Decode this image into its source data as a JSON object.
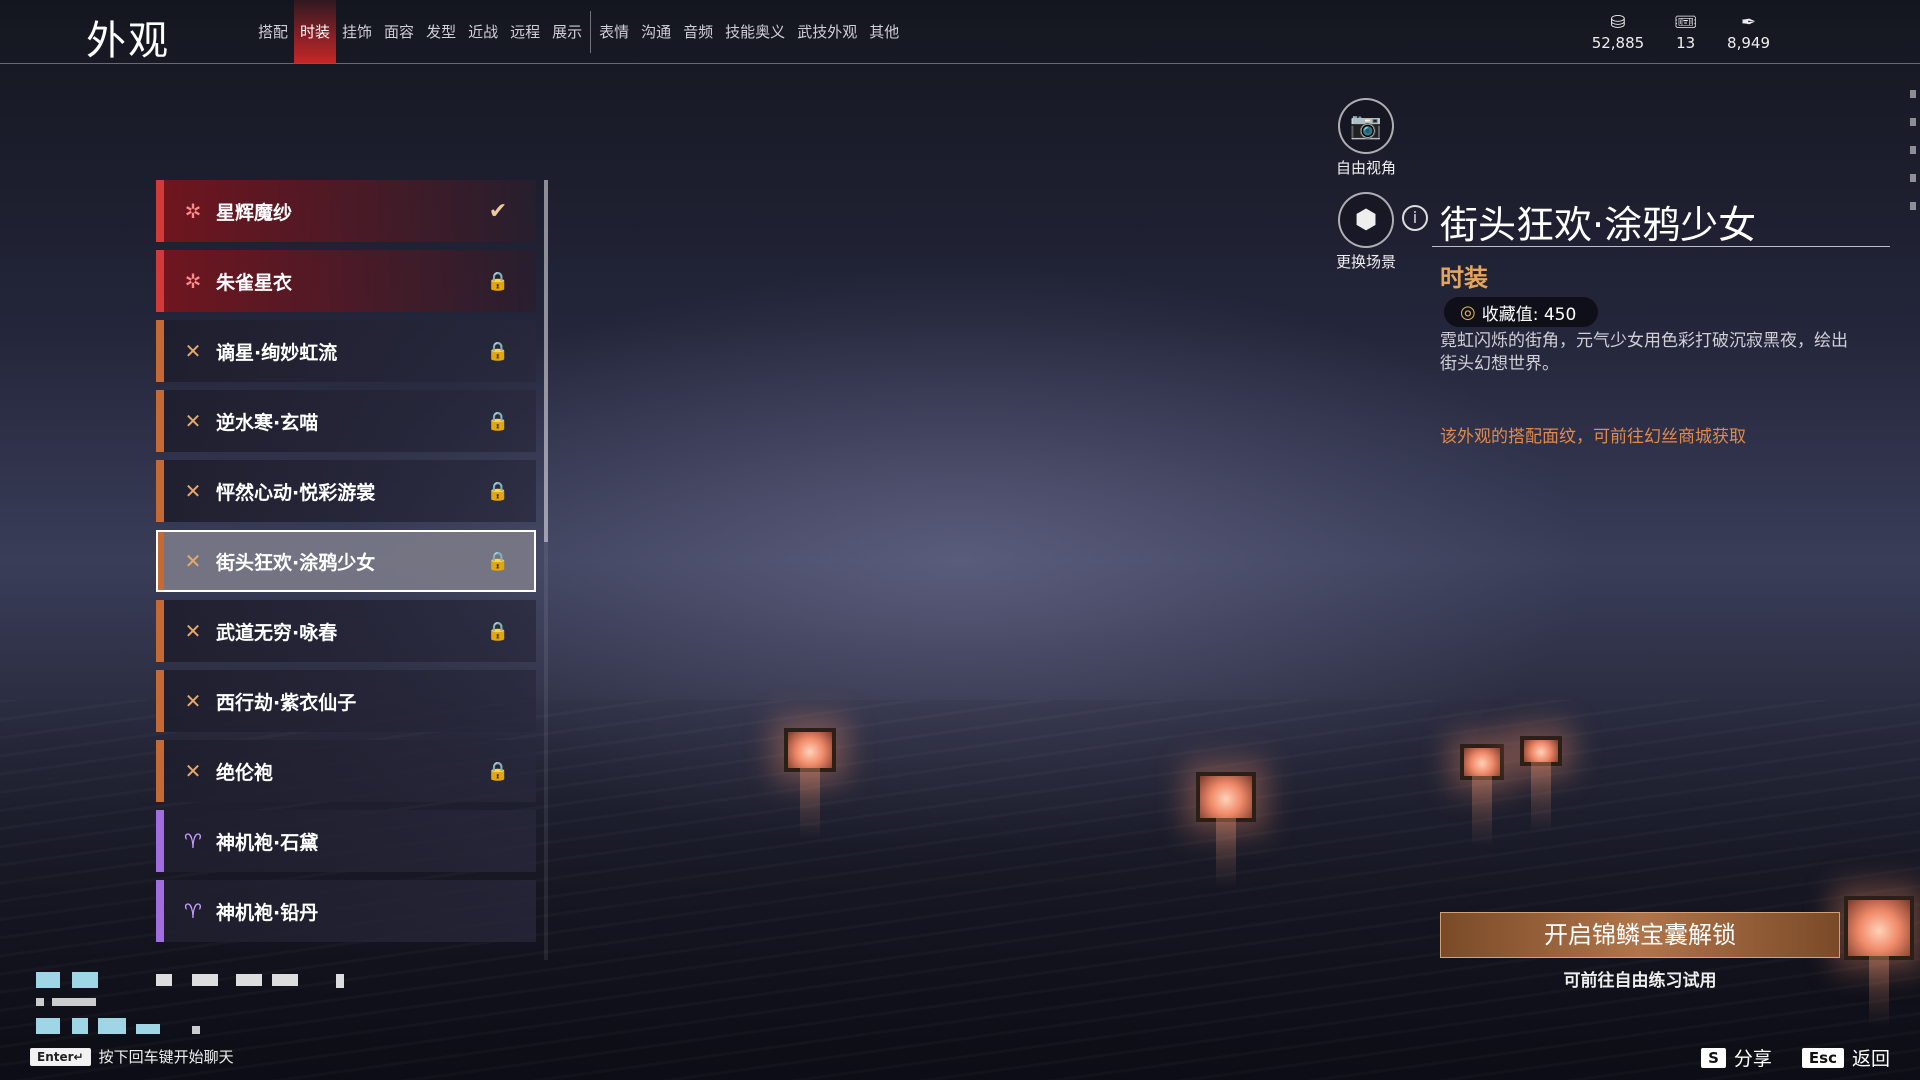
{
  "page": {
    "title": "外观"
  },
  "tabs": [
    {
      "label": "搭配",
      "active": false
    },
    {
      "label": "时装",
      "active": true
    },
    {
      "label": "挂饰",
      "active": false
    },
    {
      "label": "面容",
      "active": false
    },
    {
      "label": "发型",
      "active": false
    },
    {
      "label": "近战",
      "active": false
    },
    {
      "label": "远程",
      "active": false
    },
    {
      "label": "展示",
      "active": false
    },
    {
      "label": "表情",
      "active": false
    },
    {
      "label": "沟通",
      "active": false
    },
    {
      "label": "音频",
      "active": false
    },
    {
      "label": "技能奥义",
      "active": false
    },
    {
      "label": "武技外观",
      "active": false
    },
    {
      "label": "其他",
      "active": false
    }
  ],
  "currencies": [
    {
      "icon": "coin-stack-icon",
      "glyph": "⛁",
      "value": "52,885"
    },
    {
      "icon": "ticket-icon",
      "glyph": "🎟",
      "value": "13"
    },
    {
      "icon": "feather-icon",
      "glyph": "✒",
      "value": "8,949"
    }
  ],
  "outfits": [
    {
      "label": "星辉魔纱",
      "rarity": "red",
      "glyph": "✲",
      "status": "equipped"
    },
    {
      "label": "朱雀星衣",
      "rarity": "red",
      "glyph": "✲",
      "status": "locked"
    },
    {
      "label": "谪星·绚妙虹流",
      "rarity": "orange",
      "glyph": "✕",
      "status": "locked"
    },
    {
      "label": "逆水寒·玄喵",
      "rarity": "orange",
      "glyph": "✕",
      "status": "locked"
    },
    {
      "label": "怦然心动·悦彩游裳",
      "rarity": "orange",
      "glyph": "✕",
      "status": "locked"
    },
    {
      "label": "街头狂欢·涂鸦少女",
      "rarity": "orange",
      "glyph": "✕",
      "status": "locked",
      "selected": true
    },
    {
      "label": "武道无穷·咏春",
      "rarity": "orange",
      "glyph": "✕",
      "status": "locked"
    },
    {
      "label": "西行劫·紫衣仙子",
      "rarity": "orange",
      "glyph": "✕",
      "status": "none"
    },
    {
      "label": "绝伦袍",
      "rarity": "orange",
      "glyph": "✕",
      "status": "locked"
    },
    {
      "label": "神机袍·石黛",
      "rarity": "purple",
      "glyph": "♈",
      "status": "none"
    },
    {
      "label": "神机袍·铅丹",
      "rarity": "purple",
      "glyph": "♈",
      "status": "none"
    }
  ],
  "camera": {
    "free_view_label": "自由视角",
    "change_scene_label": "更换场景"
  },
  "detail": {
    "title": "街头狂欢·涂鸦少女",
    "category": "时装",
    "collect_value": "收藏值: 450",
    "description": "霓虹闪烁的街角，元气少女用色彩打破沉寂黑夜，绘出街头幻想世界。",
    "hint": "该外观的搭配面纹，可前往幻丝商城获取",
    "unlock_button": "开启锦鳞宝囊解锁",
    "trial_text": "可前往自由练习试用"
  },
  "footer": {
    "chat_key": "Enter↵",
    "chat_hint": "按下回车键开始聊天",
    "share_key": "S",
    "share_label": "分享",
    "back_key": "Esc",
    "back_label": "返回"
  },
  "colors": {
    "accent_red": "#d23a3a",
    "accent_orange": "#c56a35",
    "accent_purple": "#a36ce0",
    "category_gold": "#e6a55c",
    "hint_orange": "#e08a4c"
  }
}
